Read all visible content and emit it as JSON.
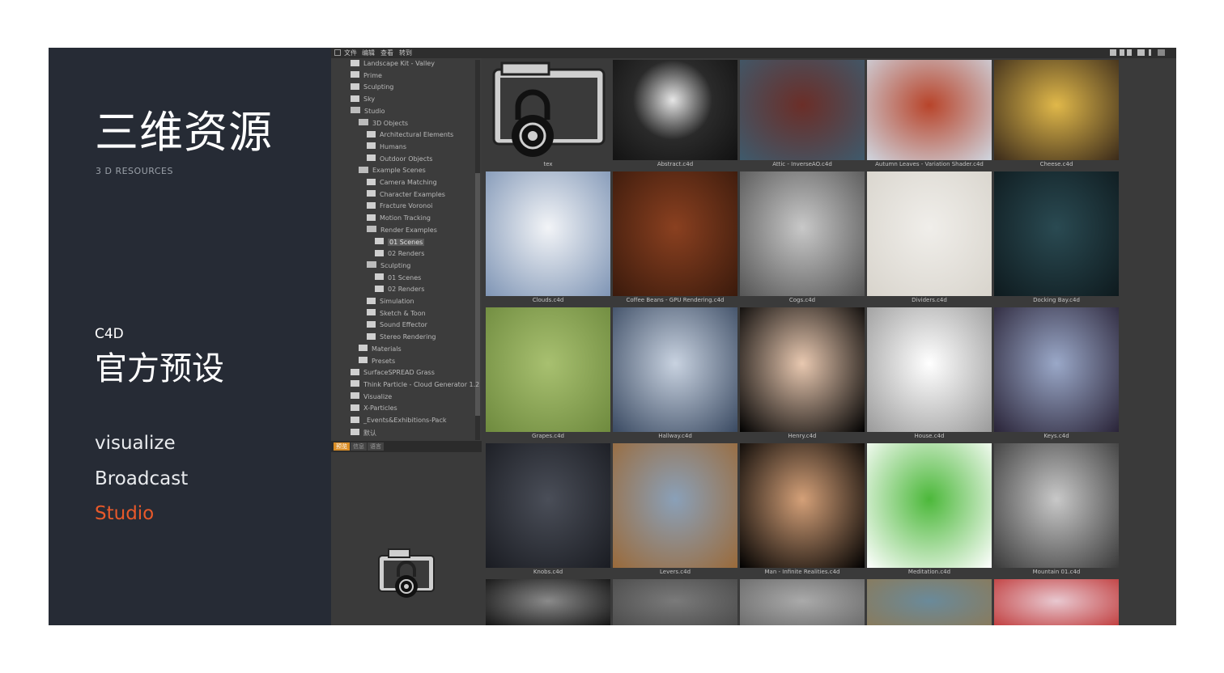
{
  "slide": {
    "title": "三维资源",
    "subtitle": "3 D RESOURCES",
    "product": "C4D",
    "preset_title": "官方预设",
    "menu": [
      {
        "label": "visualize",
        "active": false
      },
      {
        "label": "Broadcast",
        "active": false
      },
      {
        "label": "Studio",
        "active": true
      }
    ],
    "accent_color": "#e8592a"
  },
  "app": {
    "menubar": [
      "文件",
      "编辑",
      "查看",
      "转到"
    ],
    "tree": [
      {
        "label": "Landscape Kit - Valley",
        "level": 0,
        "open": false,
        "selected": false
      },
      {
        "label": "Prime",
        "level": 0,
        "open": false,
        "selected": false
      },
      {
        "label": "Sculpting",
        "level": 0,
        "open": false,
        "selected": false
      },
      {
        "label": "Sky",
        "level": 0,
        "open": false,
        "selected": false
      },
      {
        "label": "Studio",
        "level": 0,
        "open": true,
        "selected": false
      },
      {
        "label": "3D Objects",
        "level": 1,
        "open": true,
        "selected": false
      },
      {
        "label": "Architectural Elements",
        "level": 2,
        "open": false,
        "selected": false
      },
      {
        "label": "Humans",
        "level": 2,
        "open": false,
        "selected": false
      },
      {
        "label": "Outdoor Objects",
        "level": 2,
        "open": false,
        "selected": false
      },
      {
        "label": "Example Scenes",
        "level": 1,
        "open": true,
        "selected": false
      },
      {
        "label": "Camera Matching",
        "level": 2,
        "open": false,
        "selected": false
      },
      {
        "label": "Character Examples",
        "level": 2,
        "open": false,
        "selected": false
      },
      {
        "label": "Fracture Voronoi",
        "level": 2,
        "open": false,
        "selected": false
      },
      {
        "label": "Motion Tracking",
        "level": 2,
        "open": false,
        "selected": false
      },
      {
        "label": "Render Examples",
        "level": 2,
        "open": true,
        "selected": false
      },
      {
        "label": "01 Scenes",
        "level": 3,
        "open": false,
        "selected": true
      },
      {
        "label": "02 Renders",
        "level": 3,
        "open": false,
        "selected": false
      },
      {
        "label": "Sculpting",
        "level": 2,
        "open": true,
        "selected": false
      },
      {
        "label": "01 Scenes",
        "level": 3,
        "open": false,
        "selected": false
      },
      {
        "label": "02 Renders",
        "level": 3,
        "open": false,
        "selected": false
      },
      {
        "label": "Simulation",
        "level": 2,
        "open": false,
        "selected": false
      },
      {
        "label": "Sketch & Toon",
        "level": 2,
        "open": false,
        "selected": false
      },
      {
        "label": "Sound Effector",
        "level": 2,
        "open": false,
        "selected": false
      },
      {
        "label": "Stereo Rendering",
        "level": 2,
        "open": false,
        "selected": false
      },
      {
        "label": "Materials",
        "level": 1,
        "open": false,
        "selected": false
      },
      {
        "label": "Presets",
        "level": 1,
        "open": false,
        "selected": false
      },
      {
        "label": "SurfaceSPREAD Grass",
        "level": 0,
        "open": false,
        "selected": false
      },
      {
        "label": "Think Particle - Cloud Generator 1.2",
        "level": 0,
        "open": false,
        "selected": false
      },
      {
        "label": "Visualize",
        "level": 0,
        "open": false,
        "selected": false
      },
      {
        "label": "X-Particles",
        "level": 0,
        "open": false,
        "selected": false
      },
      {
        "label": "_Events&Exhibitions-Pack",
        "level": 0,
        "open": false,
        "selected": false
      },
      {
        "label": "默认",
        "level": 0,
        "open": false,
        "selected": false
      }
    ],
    "tabs": [
      {
        "label": "预览",
        "active": true
      },
      {
        "label": "信息",
        "active": false
      },
      {
        "label": "语言",
        "active": false
      }
    ],
    "assets": [
      {
        "name": "tex",
        "kind": "lock",
        "colors": [
          "#3a3a3a",
          "#3a3a3a"
        ]
      },
      {
        "name": "Abstract.c4d",
        "kind": "sphere",
        "colors": [
          "#2a2a2a",
          "#8a8a8a"
        ]
      },
      {
        "name": "Attic - InverseAO.c4d",
        "kind": "photo",
        "colors": [
          "#6b2e28",
          "#3e5a6c"
        ]
      },
      {
        "name": "Autumn Leaves - Variation Shader.c4d",
        "kind": "photo",
        "colors": [
          "#b8442a",
          "#cfd6e0"
        ]
      },
      {
        "name": "Cheese.c4d",
        "kind": "photo",
        "colors": [
          "#e0b84a",
          "#3a2a1a"
        ]
      },
      {
        "name": "Clouds.c4d",
        "kind": "photo",
        "colors": [
          "#f2f4f7",
          "#7f95b5"
        ]
      },
      {
        "name": "Coffee Beans - GPU Rendering.c4d",
        "kind": "photo",
        "colors": [
          "#8a4020",
          "#3a1a0c"
        ]
      },
      {
        "name": "Cogs.c4d",
        "kind": "photo",
        "colors": [
          "#c8c8c8",
          "#555555"
        ]
      },
      {
        "name": "Dividers.c4d",
        "kind": "photo",
        "colors": [
          "#f0eeea",
          "#d8d4cc"
        ]
      },
      {
        "name": "Docking Bay.c4d",
        "kind": "photo",
        "colors": [
          "#2a4a52",
          "#0e1a1e"
        ]
      },
      {
        "name": "Grapes.c4d",
        "kind": "photo",
        "colors": [
          "#a8c070",
          "#6e8a3e"
        ]
      },
      {
        "name": "Hallway.c4d",
        "kind": "photo",
        "colors": [
          "#c8d2e0",
          "#3a4a62"
        ]
      },
      {
        "name": "Henry.c4d",
        "kind": "photo",
        "colors": [
          "#e8c8b0",
          "#000000"
        ]
      },
      {
        "name": "House.c4d",
        "kind": "photo",
        "colors": [
          "#ffffff",
          "#9a9a9a"
        ]
      },
      {
        "name": "Keys.c4d",
        "kind": "photo",
        "colors": [
          "#9aa8c8",
          "#2a2438"
        ]
      },
      {
        "name": "Knobs.c4d",
        "kind": "photo",
        "colors": [
          "#4a4e58",
          "#1a1c22"
        ]
      },
      {
        "name": "Levers.c4d",
        "kind": "photo",
        "colors": [
          "#8aa0b8",
          "#9a6a3a"
        ]
      },
      {
        "name": "Man - Infinite Realities.c4d",
        "kind": "photo",
        "colors": [
          "#d4a078",
          "#000000"
        ]
      },
      {
        "name": "Meditation.c4d",
        "kind": "photo",
        "colors": [
          "#4cb83a",
          "#ffffff"
        ]
      },
      {
        "name": "Mountain 01.c4d",
        "kind": "photo",
        "colors": [
          "#c8c8c8",
          "#3a3a3a"
        ]
      },
      {
        "name": "",
        "kind": "photo",
        "colors": [
          "#8a8a8a",
          "#101010"
        ]
      },
      {
        "name": "",
        "kind": "photo",
        "colors": [
          "#7a7a7a",
          "#4a4a4a"
        ]
      },
      {
        "name": "",
        "kind": "photo",
        "colors": [
          "#aaaaaa",
          "#6a6a6a"
        ]
      },
      {
        "name": "",
        "kind": "photo",
        "colors": [
          "#6a8a9a",
          "#8a7a5a"
        ]
      },
      {
        "name": "",
        "kind": "photo",
        "colors": [
          "#e8c8d0",
          "#c03a3a"
        ]
      }
    ]
  }
}
